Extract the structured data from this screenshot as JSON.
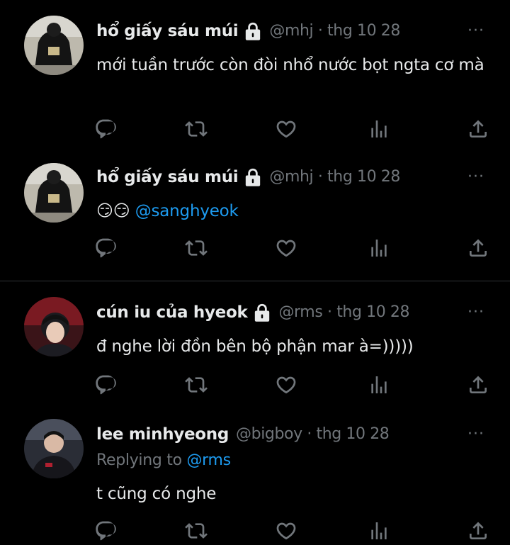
{
  "tweets": [
    {
      "name": "hổ giấy sáu múi",
      "handle": "@mhj",
      "date": "thg 10 28",
      "text": "mới tuần trước còn đòi nhổ nước bọt ngta cơ mà",
      "locked": true
    },
    {
      "name": "hổ giấy sáu múi",
      "handle": "@mhj",
      "date": "thg 10 28",
      "emoji": "😏😏",
      "mention": "@sanghyeok",
      "locked": true
    },
    {
      "name": "cún iu của hyeok",
      "handle": "@rms",
      "date": "thg 10 28",
      "text": "đ nghe lời đồn bên bộ phận mar à=)))))",
      "locked": true
    },
    {
      "name": "lee minhyeong",
      "handle": "@bigboy",
      "date": "thg 10 28",
      "replying_prefix": "Replying to",
      "replying_to": "@rms",
      "text": "t cũng có nghe",
      "locked": false
    }
  ],
  "separator": "·",
  "more_glyph": "···",
  "icons": [
    "reply-icon",
    "retweet-icon",
    "like-icon",
    "analytics-icon",
    "share-icon"
  ],
  "colors": {
    "background": "#000000",
    "text": "#e7e9ea",
    "muted": "#71767b",
    "link": "#1d9bf0",
    "divider": "#2f3336"
  }
}
